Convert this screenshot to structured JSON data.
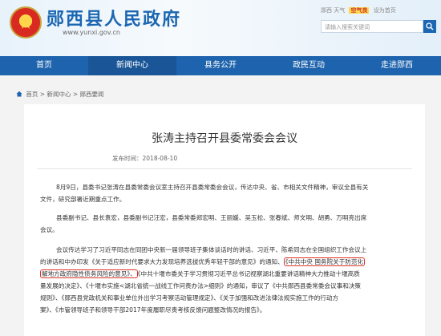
{
  "header": {
    "title": "郧西县人民政府",
    "url": "www.yunxi.gov.cn",
    "top_links": [
      "郧西 天气",
      "空气良",
      "设为首页"
    ],
    "search_placeholder": "请输入搜索关键词"
  },
  "nav": {
    "items": [
      {
        "label": "首页",
        "active": false
      },
      {
        "label": "新闻中心",
        "active": true
      },
      {
        "label": "县务公开",
        "active": false
      },
      {
        "label": "政民互动",
        "active": false
      },
      {
        "label": "走进郧西",
        "active": false
      }
    ]
  },
  "breadcrumb": {
    "items": [
      "首页",
      "新闻中心",
      "郧西要闻"
    ],
    "separator": ">"
  },
  "article": {
    "title": "张涛主持召开县委常委会会议",
    "meta_label": "发布时间：",
    "date": "2018-08-10",
    "p1": [
      "8月9日，县委书记张涛在县委常委会议室主持召开县委常委会会议，传达中央、省、市相关文件精神，审议全县有关",
      "文件，研究部署近期重点工作。"
    ],
    "p2": [
      "县委副书记、县长袁宏，县委副书记汪宏，县委常委郑宏明、王丽媛、吴玉松、张春斌、师文明、胡勇、万明亮出席",
      "会议。"
    ],
    "p3": {
      "l1": "会议传达学习了习近平同志在同团中央新一届领导班子集体谈话时的讲话、习近平、陈希同志在全国组织工作会议上",
      "l2_pre": "的讲话和中办印发《关于适应新时代要求大力发现培养选拔优秀年轻干部的意见》的通知、",
      "l2_hl": "《中共中央 国务院关于防范化",
      "l3_hl": "解地方政府隐性债务风险的意见》、",
      "l3_post": "《中共十堰市委关于学习贯彻习近平总书记视察湖北重要讲话精神大力推动十堰高质",
      "l4": "量发展的决定》、《十堰市实施<湖北省统一战线工作问责办法>细则》的通知，审议了《中共郧西县委常委会议事和决策",
      "l5": "规则》、《郧西县党政机关和事业单位外出学习考察活动管理规定》、《关于加强和改进法律法规实施工作的行动方",
      "l6": "案》、《市管领导班子和领导干部2017年度履职尽责考核反馈问题整改情况的报告》。"
    }
  },
  "colors": {
    "brand_blue": "#1e63ad",
    "title_blue": "#1b67b2",
    "highlight_red": "#e0332b"
  },
  "icons": [
    "emblem-icon",
    "search-icon",
    "home-icon"
  ]
}
